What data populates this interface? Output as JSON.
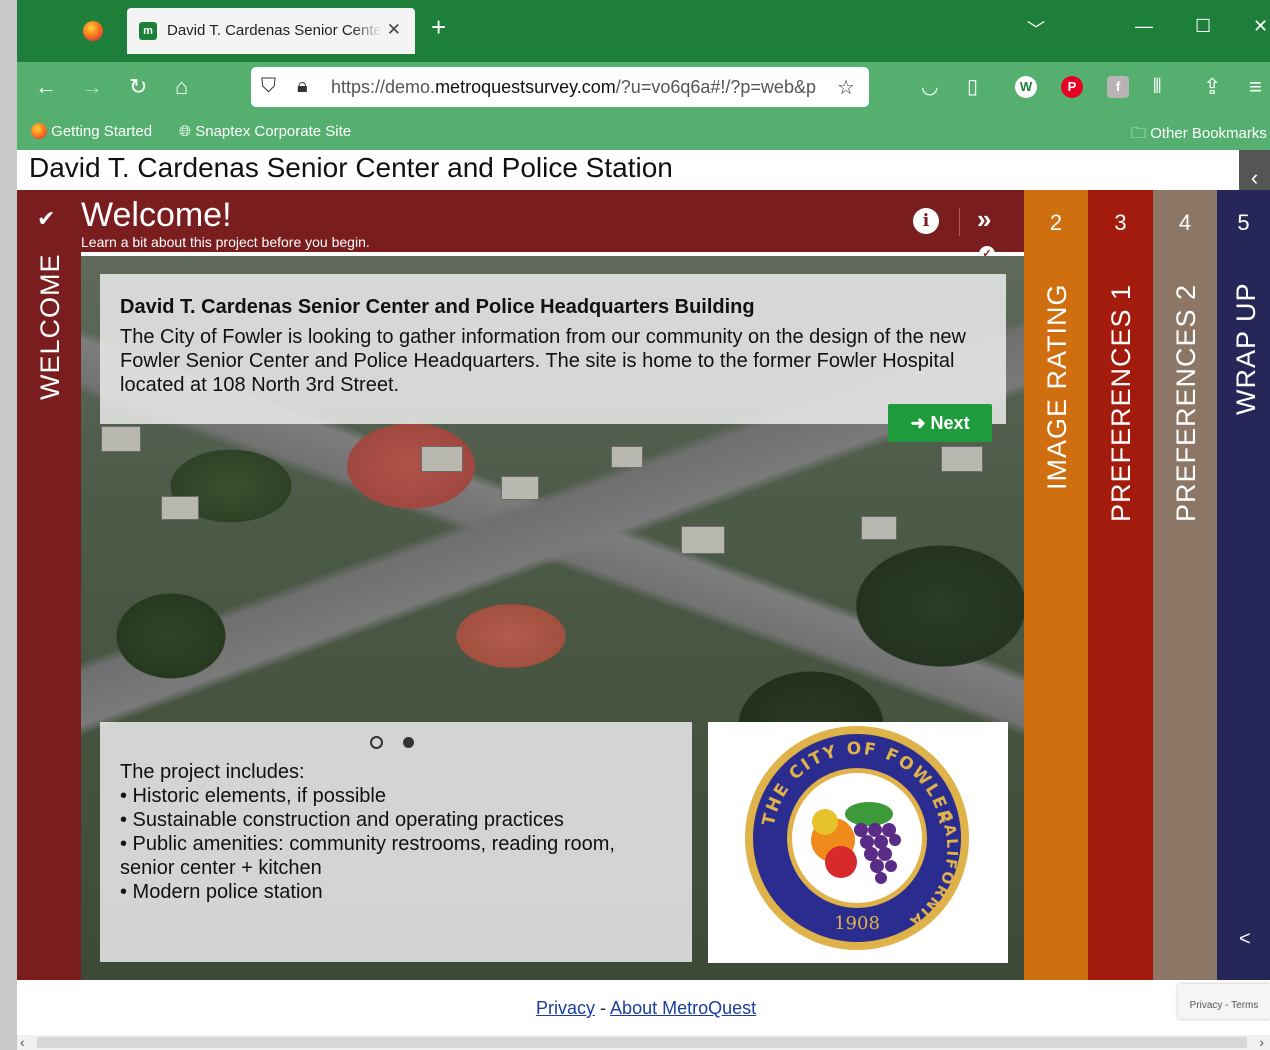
{
  "browser": {
    "tab_title": "David T. Cardenas Senior Center and Police Station",
    "tab_icon_label": "m",
    "new_tab": "+",
    "url_host_prefix": "https://demo.",
    "url_host": "metroquestsurvey.com",
    "url_path": "/?u=vo6q6a#!/?p=web&p",
    "bookmarks": [
      "Getting Started",
      "Snaptex Corporate Site"
    ],
    "other_bookmarks": "Other Bookmarks",
    "icons": [
      "back-icon",
      "forward-icon",
      "reload-icon",
      "home-icon",
      "shield-icon",
      "lock-icon",
      "star-icon",
      "pocket-icon",
      "reader-icon",
      "w-extension-icon",
      "pinterest-icon",
      "extension-icon",
      "library-icon",
      "share-icon",
      "menu-icon"
    ]
  },
  "page": {
    "title": "David T. Cardenas Senior Center and Police Station"
  },
  "welcome": {
    "side_label": "WELCOME",
    "title": "Welcome!",
    "subtitle": "Learn a bit about this project before you begin.",
    "card_title": "David T. Cardenas Senior Center and Police Headquarters Building",
    "card_body": "The City of Fowler is looking to gather information from our community on the design of the new Fowler Senior Center and Police Headquarters. The site is home to the former Fowler Hospital located at 108 North 3rd Street.",
    "next_label": "Next",
    "slide_index": 2,
    "slide_count": 2,
    "list_intro": "The project includes:",
    "list_items": [
      "• Historic elements, if possible",
      "• Sustainable construction and operating practices",
      "• Public amenities: community restrooms, reading room, senior center + kitchen",
      "• Modern police station"
    ],
    "seal": {
      "top_text": "THE CITY OF FOWLER",
      "side_text": "CALIFORNIA",
      "year": "1908"
    }
  },
  "steps": [
    {
      "number": "2",
      "label": "IMAGE RATING",
      "color": "#d06f10"
    },
    {
      "number": "3",
      "label": "PREFERENCES 1",
      "color": "#a31b0c"
    },
    {
      "number": "4",
      "label": "PREFERENCES 2",
      "color": "#8c7767"
    },
    {
      "number": "5",
      "label": "WRAP UP",
      "color": "#262658"
    }
  ],
  "footer": {
    "privacy": "Privacy",
    "separator": "-",
    "about": "About MetroQuest",
    "recaptcha": "Privacy - Terms"
  }
}
